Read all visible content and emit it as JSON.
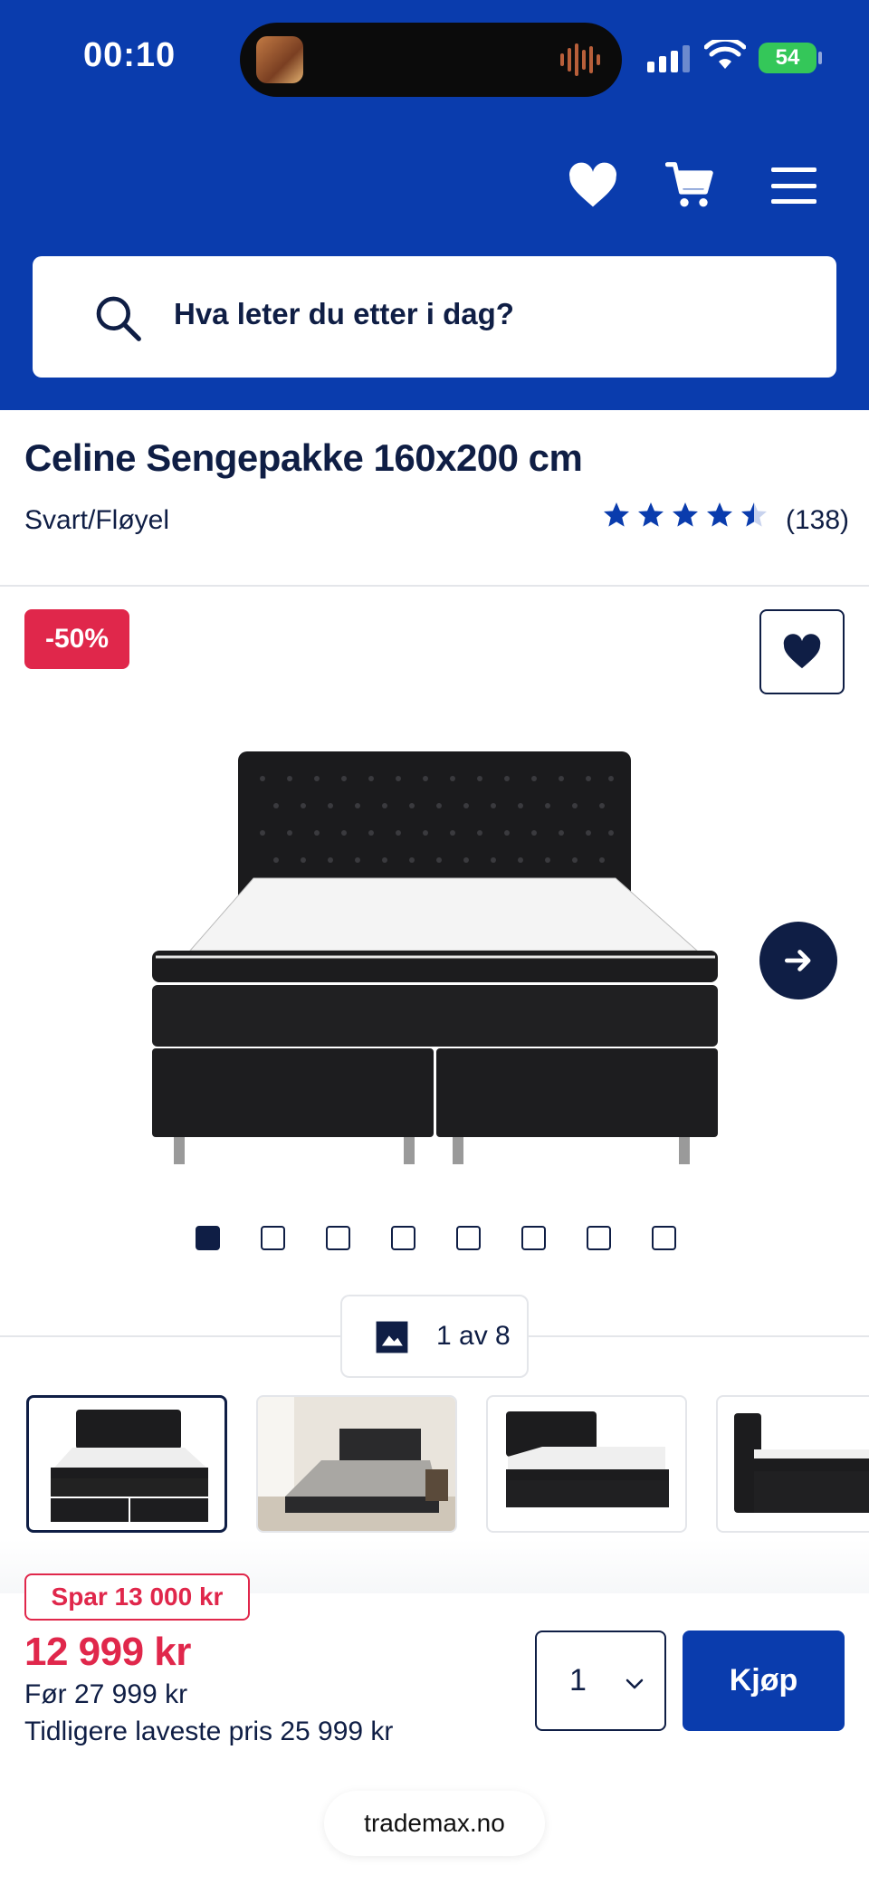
{
  "status_bar": {
    "time": "00:10",
    "battery": "54"
  },
  "header": {
    "search_placeholder": "Hva leter du etter i dag?",
    "icons": [
      "heart-icon",
      "cart-icon",
      "menu-icon"
    ]
  },
  "product": {
    "title": "Celine Sengepakke 160x200 cm",
    "variant": "Svart/Fløyel",
    "rating": 4.5,
    "rating_max": 5,
    "review_count": "(138)"
  },
  "gallery": {
    "discount_badge": "-50%",
    "counter": "1 av 8",
    "total_images": 8,
    "active_index": 0
  },
  "pricing": {
    "save_badge": "Spar 13 000 kr",
    "price_now": "12 999 kr",
    "price_before": "Før 27 999 kr",
    "lowest_price": "Tidligere laveste pris 25 999 kr",
    "quantity": "1",
    "buy_label": "Kjøp"
  },
  "browser": {
    "url": "trademax.no"
  },
  "colors": {
    "brand_blue": "#0a3cad",
    "navy": "#0f1e45",
    "sale_red": "#e0274b"
  }
}
